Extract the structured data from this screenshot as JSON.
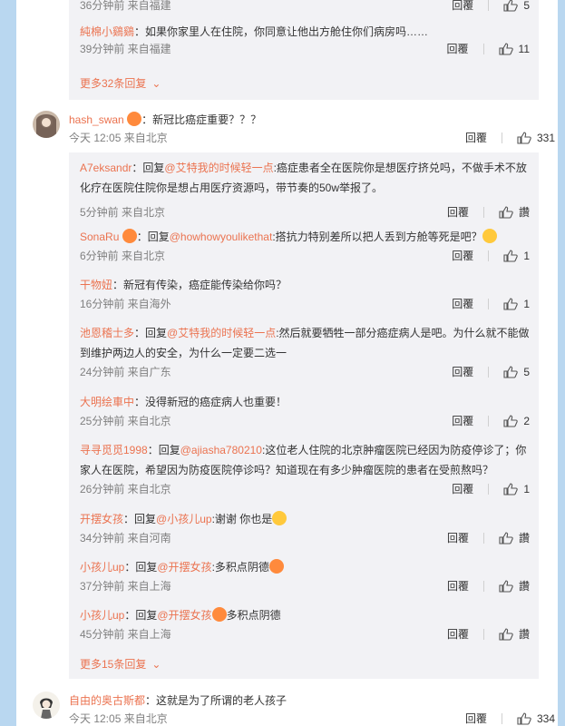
{
  "reply_label": "回覆",
  "top_replies": [
    {
      "meta": "36分钟前 来自福建",
      "likes": "5"
    },
    {
      "user": "純棉小鷄鷄",
      "text": "：如果你家里人在住院，你同意让他出方舱住你们病房吗……",
      "meta": "39分钟前 来自福建",
      "likes": "11"
    }
  ],
  "top_more": "更多32条回复",
  "comment1": {
    "user": "hash_swan",
    "text": "：新冠比癌症重要？？？",
    "meta": "今天 12:05 来自北京",
    "likes": "331"
  },
  "replies": [
    {
      "user": "A7eksandr",
      "prefix": "：回复",
      "mention": "@艾特我的时候轻一点",
      "text": ":癌症患者全在医院你是想医疗挤兑吗，不做手术不放化疗在医院住院你是想占用医疗资源吗，带节奏的50w举报了。",
      "meta": "5分钟前 来自北京",
      "likes": "讚"
    },
    {
      "user": "SonaRu",
      "prefix": "：回复",
      "mention": "@howhowyoulikethat",
      "text": ":搭抗力特别差所以把人丢到方舱等死是吧？",
      "meta": "6分钟前 来自北京",
      "likes": "1"
    },
    {
      "user": "干物妞",
      "prefix": "",
      "mention": "",
      "text": "：新冠有传染，癌症能传染给你吗？",
      "meta": "16分钟前 来自海外",
      "likes": "1"
    },
    {
      "user": "池恩稽士多",
      "prefix": "：回复",
      "mention": "@艾特我的时候轻一点",
      "text": ":然后就要牺牲一部分癌症病人是吧。为什么就不能做到维护两边人的安全，为什么一定要二选一",
      "meta": "24分钟前 来自广东",
      "likes": "5"
    },
    {
      "user": "大明绘車中",
      "prefix": "",
      "mention": "",
      "text": "：没得新冠的癌症病人也重要！",
      "meta": "25分钟前 来自北京",
      "likes": "2"
    },
    {
      "user": "寻寻觅觅1998",
      "prefix": "：回复",
      "mention": "@ajiasha780210",
      "text": ":这位老人住院的北京肿瘤医院已经因为防疫停诊了；你家人在医院，希望因为防疫医院停诊吗？知道现在有多少肿瘤医院的患者在受煎熬吗？",
      "meta": "26分钟前 来自北京",
      "likes": "1"
    },
    {
      "user": "开摆女孩",
      "prefix": "：回复",
      "mention": "@小孩儿up",
      "text": ":谢谢 你也是",
      "meta": "34分钟前 来自河南",
      "likes": "讚"
    },
    {
      "user": "小孩儿up",
      "prefix": "：回复",
      "mention": "@开摆女孩",
      "text": ":多积点阴德",
      "meta": "37分钟前 来自上海",
      "likes": "讚"
    },
    {
      "user": "小孩儿up",
      "prefix": "：回复",
      "mention": "@开摆女孩",
      "text": "多积点阴德",
      "meta": "45分钟前 来自上海",
      "likes": "讚"
    }
  ],
  "replies_more": "更多15条回复",
  "comment2": {
    "user": "自由的奥古斯都",
    "text": "：这就是为了所谓的老人孩子",
    "meta": "今天 12:05 来自北京",
    "likes": "334"
  },
  "colors": {
    "accent": "#eb7350",
    "meta": "#808080",
    "reply_bg": "#f2f2f5",
    "page_bg": "#b9d7f0"
  }
}
